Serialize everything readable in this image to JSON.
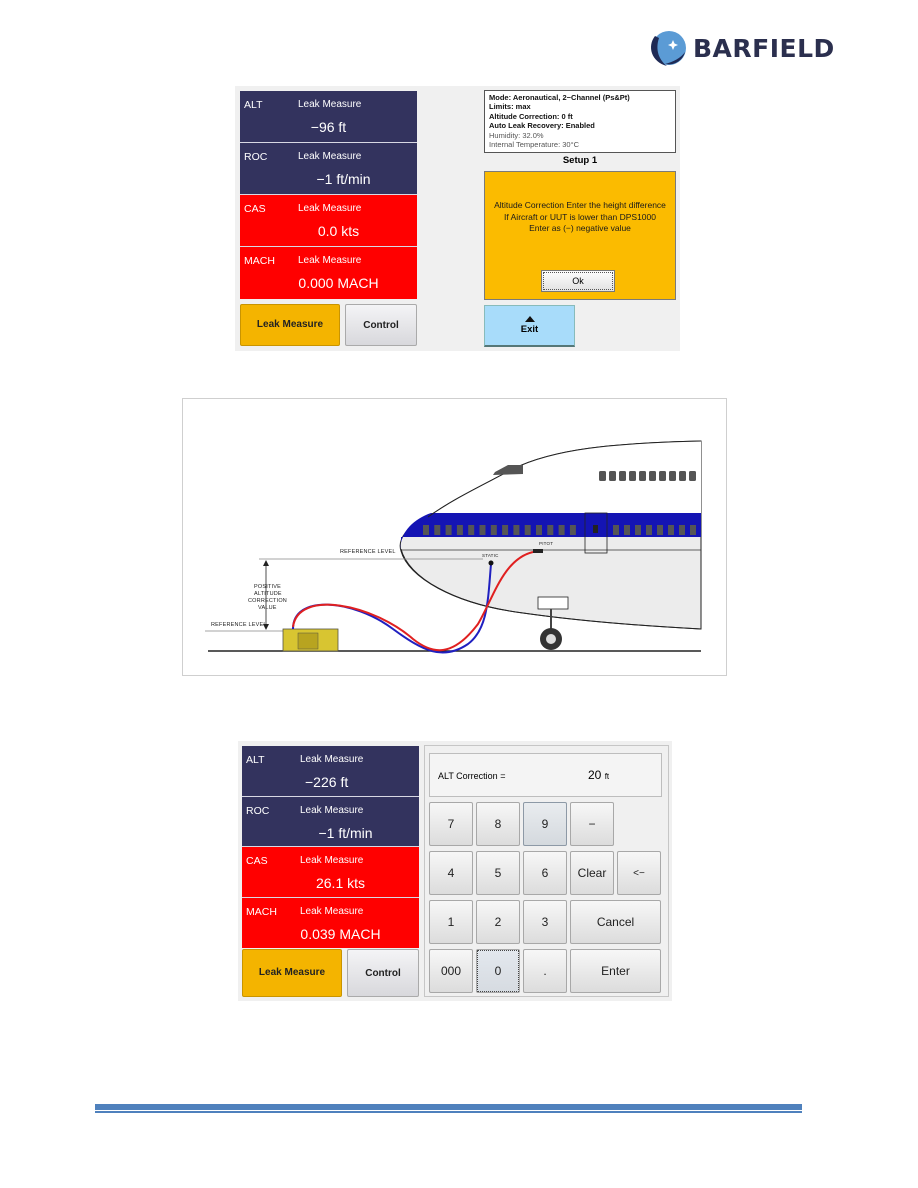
{
  "brand": {
    "name": "BARFIELD",
    "icon": "barfield-globe-logo-icon",
    "color": "#2b2f4e"
  },
  "screen1": {
    "readouts": [
      {
        "label": "ALT",
        "mode": "Leak Measure",
        "value": "−96",
        "unit": "ft",
        "color": "#33335e"
      },
      {
        "label": "ROC",
        "mode": "Leak Measure",
        "value": "−1",
        "unit": "ft/min",
        "color": "#33335e"
      },
      {
        "label": "CAS",
        "mode": "Leak Measure",
        "value": "0.0",
        "unit": "kts",
        "color": "#ff0000"
      },
      {
        "label": "MACH",
        "mode": "Leak Measure",
        "value": "0.000",
        "unit": "MACH",
        "color": "#ff0000"
      }
    ],
    "buttons": {
      "leak_measure": "Leak Measure",
      "control": "Control"
    },
    "info": {
      "mode": "Mode: Aeronautical, 2−Channel (Ps&Pt)",
      "limits": "Limits: max",
      "altitude_correction": "Altitude Correction: 0 ft",
      "auto_leak_recovery": "Auto Leak Recovery: Enabled",
      "humidity": "Humidity: 32.0%",
      "internal_temperature": "Internal Temperature: 30°C"
    },
    "setup_title": "Setup 1",
    "alert": {
      "message": "Altitude Correction Enter the height difference If Aircraft or UUT is lower than DPS1000 Enter as (−) negative value",
      "ok_label": "Ok",
      "background": "#fbbb00"
    },
    "exit": {
      "label": "Exit",
      "icon": "up-arrow-icon"
    }
  },
  "diagram": {
    "labels": {
      "reference_level_upper": "REFERENCE LEVEL",
      "reference_level_lower": "REFERENCE LEVEL",
      "correction_value": [
        "POSITIVE",
        "ALTITUDE",
        "CORRECTION",
        "VALUE"
      ],
      "static_port": "STATIC",
      "pitot_port": "PITOT"
    },
    "hose_colors": {
      "static": "#2020c0",
      "pitot": "#e02020"
    },
    "fuselage_stripe": "#1414b4"
  },
  "screen2": {
    "readouts": [
      {
        "label": "ALT",
        "mode": "Leak Measure",
        "value": "−226",
        "unit": "ft",
        "color": "#33335e"
      },
      {
        "label": "ROC",
        "mode": "Leak Measure",
        "value": "−1",
        "unit": "ft/min",
        "color": "#33335e"
      },
      {
        "label": "CAS",
        "mode": "Leak Measure",
        "value": "26.1",
        "unit": "kts",
        "color": "#ff0000"
      },
      {
        "label": "MACH",
        "mode": "Leak Measure",
        "value": "0.039",
        "unit": "MACH",
        "color": "#ff0000"
      }
    ],
    "buttons": {
      "leak_measure": "Leak Measure",
      "control": "Control"
    },
    "alt_correction": {
      "label": "ALT Correction =",
      "value": "20",
      "unit": "ft"
    },
    "keys": {
      "k7": "7",
      "k8": "8",
      "k9": "9",
      "minus": "−",
      "k4": "4",
      "k5": "5",
      "k6": "6",
      "clear": "Clear",
      "backspace": "<−",
      "k1": "1",
      "k2": "2",
      "k3": "3",
      "cancel": "Cancel",
      "k000": "000",
      "k0": "0",
      "dot": ".",
      "enter": "Enter"
    }
  },
  "footer": {
    "rule_color": "#4f81bd"
  }
}
